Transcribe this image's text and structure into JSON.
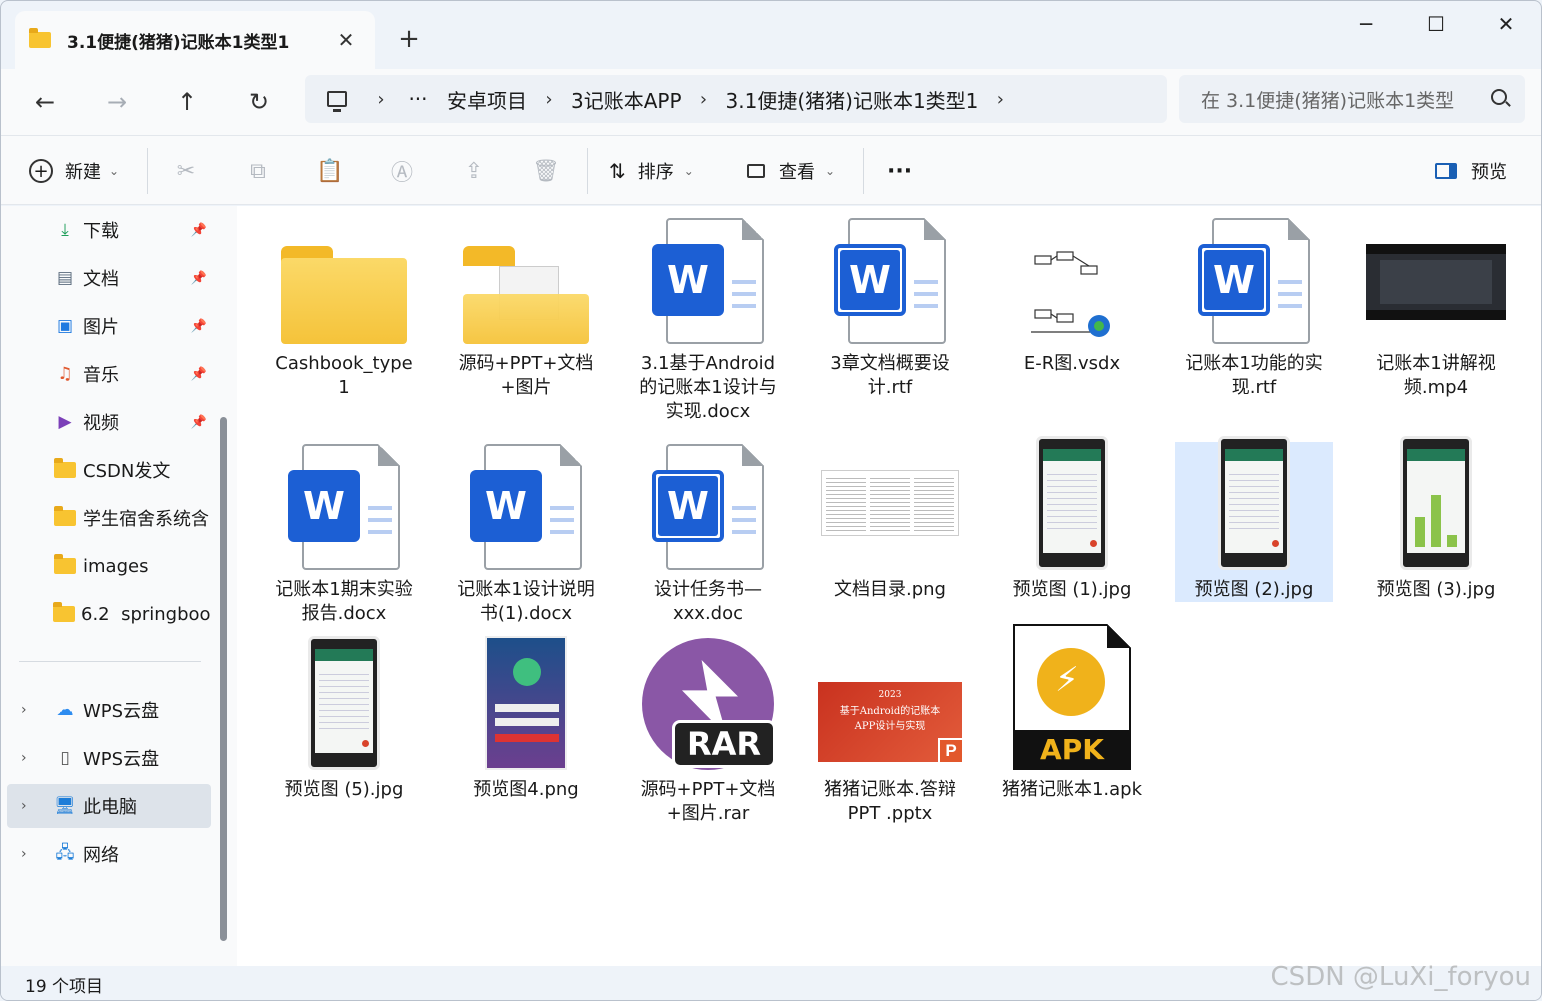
{
  "window": {
    "tab_title": "3.1便捷(猪猪)记账本1类型1",
    "tab_close": "✕",
    "new_tab": "+",
    "minimize": "─",
    "maximize": "☐",
    "close": "✕"
  },
  "nav": {
    "back": "←",
    "forward": "→",
    "up": "↑",
    "refresh": "↻",
    "more": "···",
    "breadcrumbs": [
      "安卓项目",
      "3记账本APP",
      "3.1便捷(猪猪)记账本1类型1"
    ],
    "search_placeholder": "在 3.1便捷(猪猪)记账本1类型"
  },
  "toolbar": {
    "new_label": "新建",
    "sort_label": "排序",
    "view_label": "查看",
    "more": "···",
    "preview_label": "预览"
  },
  "sidebar": {
    "quick": [
      {
        "label": "下载",
        "icon": "download-icon",
        "pinned": true
      },
      {
        "label": "文档",
        "icon": "document-icon",
        "pinned": true
      },
      {
        "label": "图片",
        "icon": "picture-icon",
        "pinned": true
      },
      {
        "label": "音乐",
        "icon": "music-icon",
        "pinned": true
      },
      {
        "label": "视频",
        "icon": "video-icon",
        "pinned": true
      },
      {
        "label": "CSDN发文",
        "icon": "folder-icon",
        "pinned": false
      },
      {
        "label": "学生宿舍系统含",
        "icon": "folder-icon",
        "pinned": false
      },
      {
        "label": "images",
        "icon": "folder-icon",
        "pinned": false
      },
      {
        "label": "6.2  springboot",
        "icon": "folder-icon",
        "pinned": false
      }
    ],
    "tree": [
      {
        "label": "WPS云盘",
        "icon": "cloud-icon"
      },
      {
        "label": "WPS云盘",
        "icon": "file-icon"
      },
      {
        "label": "此电脑",
        "icon": "computer-icon",
        "selected": true
      },
      {
        "label": "网络",
        "icon": "network-icon"
      }
    ]
  },
  "files": [
    {
      "name": "Cashbook_type\n1",
      "kind": "folder"
    },
    {
      "name": "源码+PPT+文档\n+图片",
      "kind": "folder-doc"
    },
    {
      "name": "3.1基于Android\n的记账本1设计与\n实现.docx",
      "kind": "word"
    },
    {
      "name": "3章文档概要设\n计.rtf",
      "kind": "word-outline"
    },
    {
      "name": "E-R图.vsdx",
      "kind": "vsdx"
    },
    {
      "name": "记账本1功能的实\n现.rtf",
      "kind": "word-outline"
    },
    {
      "name": "记账本1讲解视\n频.mp4",
      "kind": "video"
    },
    {
      "name": "记账本1期末实验\n报告.docx",
      "kind": "word"
    },
    {
      "name": "记账本1设计说明\n书(1).docx",
      "kind": "word"
    },
    {
      "name": "设计任务书—\nxxx.doc",
      "kind": "word-outline"
    },
    {
      "name": "文档目录.png",
      "kind": "png-doc"
    },
    {
      "name": "预览图 (1).jpg",
      "kind": "phone"
    },
    {
      "name": "预览图 (2).jpg",
      "kind": "phone",
      "selected": true
    },
    {
      "name": "预览图 (3).jpg",
      "kind": "phone-chart"
    },
    {
      "name": "预览图 (5).jpg",
      "kind": "phone"
    },
    {
      "name": "预览图4.png",
      "kind": "phone-login"
    },
    {
      "name": "源码+PPT+文档\n+图片.rar",
      "kind": "rar"
    },
    {
      "name": "猪猪记账本.答辩\nPPT .pptx",
      "kind": "pptx"
    },
    {
      "name": "猪猪记账本1.apk",
      "kind": "apk"
    }
  ],
  "thumbs": {
    "rar_label": "RAR",
    "apk_label": "APK",
    "word_letter": "W",
    "ppt_letter": "P",
    "ppt_year": "2023",
    "ppt_title": "基于Android的记账本APP设计与实现"
  },
  "status": {
    "count": "19 个项目"
  },
  "watermark": "CSDN @LuXi_foryou"
}
